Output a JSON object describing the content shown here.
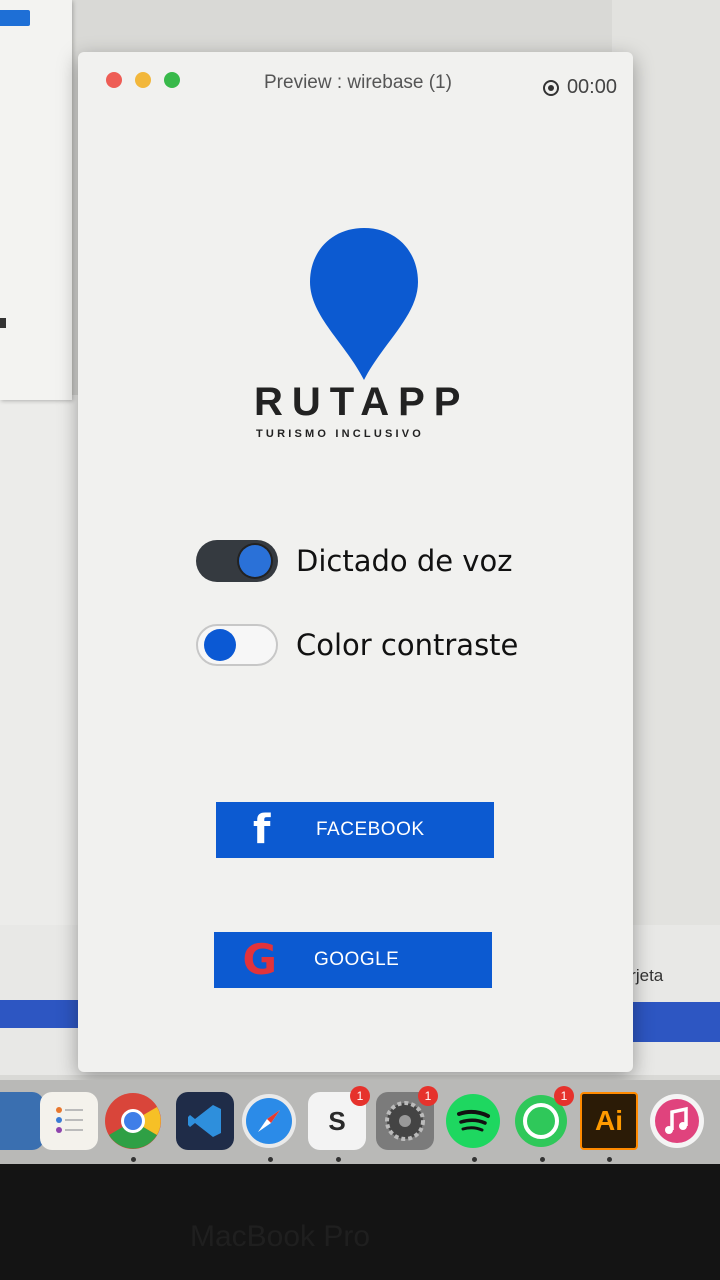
{
  "window": {
    "title": "Preview : wirebase (1)",
    "record_time": "00:00"
  },
  "app": {
    "logo_name": "RUTAPP",
    "logo_tagline": "TURISMO INCLUSIVO",
    "brand_color": "#0c5ad1"
  },
  "toggles": [
    {
      "label": "Dictado de voz",
      "on": true
    },
    {
      "label": "Color contraste",
      "on": false
    }
  ],
  "buttons": {
    "facebook": {
      "label": "FACEBOOK",
      "icon": "facebook-icon",
      "glyph": "f"
    },
    "google": {
      "label": "GOOGLE",
      "icon": "google-icon",
      "glyph": "G"
    }
  },
  "background": {
    "side_text": "tarjeta"
  },
  "dock": {
    "apps": [
      {
        "name": "preview-dock-icon"
      },
      {
        "name": "reminders-dock-icon"
      },
      {
        "name": "chrome-dock-icon"
      },
      {
        "name": "vscode-dock-icon"
      },
      {
        "name": "safari-dock-icon"
      },
      {
        "name": "slack-dock-icon",
        "badge": "1"
      },
      {
        "name": "system-preferences-dock-icon",
        "badge": "1"
      },
      {
        "name": "spotify-dock-icon"
      },
      {
        "name": "whatsapp-dock-icon",
        "badge": "1"
      },
      {
        "name": "illustrator-dock-icon",
        "text": "Ai"
      },
      {
        "name": "itunes-dock-icon"
      }
    ]
  },
  "bezel_text": "MacBook Pro"
}
